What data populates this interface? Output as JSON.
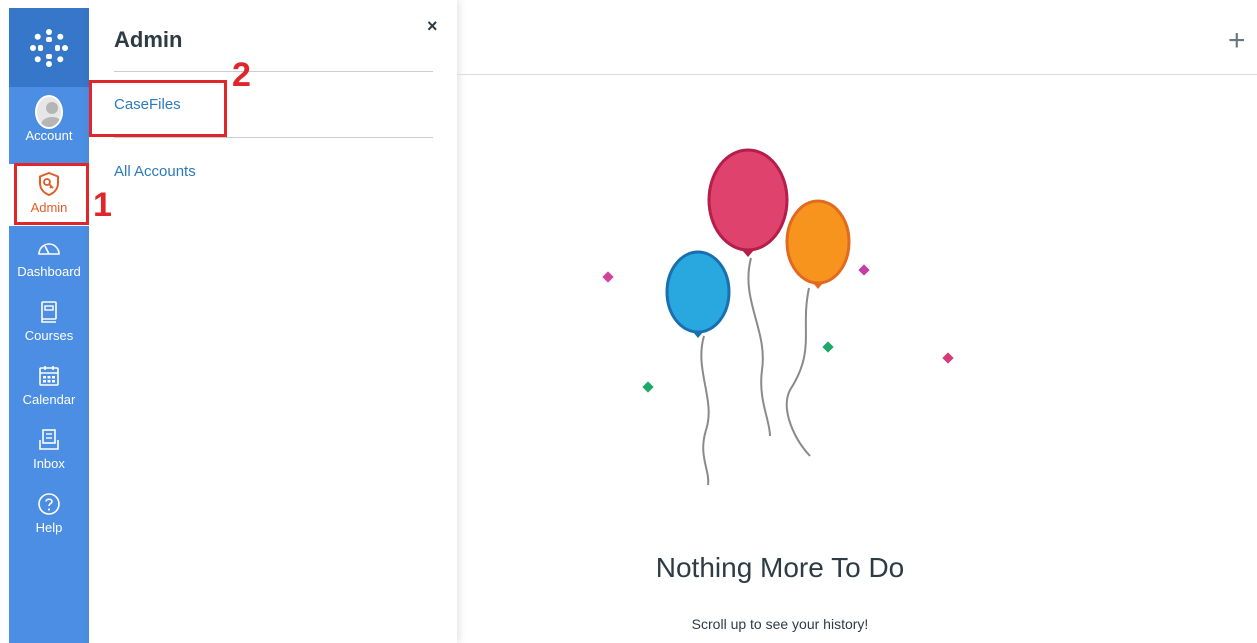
{
  "nav": {
    "items": [
      {
        "label": "Account"
      },
      {
        "label": "Admin"
      },
      {
        "label": "Dashboard"
      },
      {
        "label": "Courses"
      },
      {
        "label": "Calendar"
      },
      {
        "label": "Inbox"
      },
      {
        "label": "Help"
      }
    ]
  },
  "tray": {
    "title": "Admin",
    "close": "×",
    "links": [
      {
        "label": "CaseFiles"
      },
      {
        "label": "All Accounts"
      }
    ]
  },
  "main": {
    "add_symbol": "+",
    "empty_title": "Nothing More To Do",
    "empty_subtitle": "Scroll up to see your history!"
  },
  "annotations": [
    {
      "number": "1"
    },
    {
      "number": "2"
    }
  ],
  "colors": {
    "nav_bg": "#4b8ee3",
    "nav_logo_bg": "#3777c9",
    "active_accent": "#e25c29",
    "link": "#2b7abc",
    "annotation": "#e0262b",
    "balloon_pink": "#e0426e",
    "balloon_blue": "#29a8e0",
    "balloon_orange": "#f7941e"
  }
}
